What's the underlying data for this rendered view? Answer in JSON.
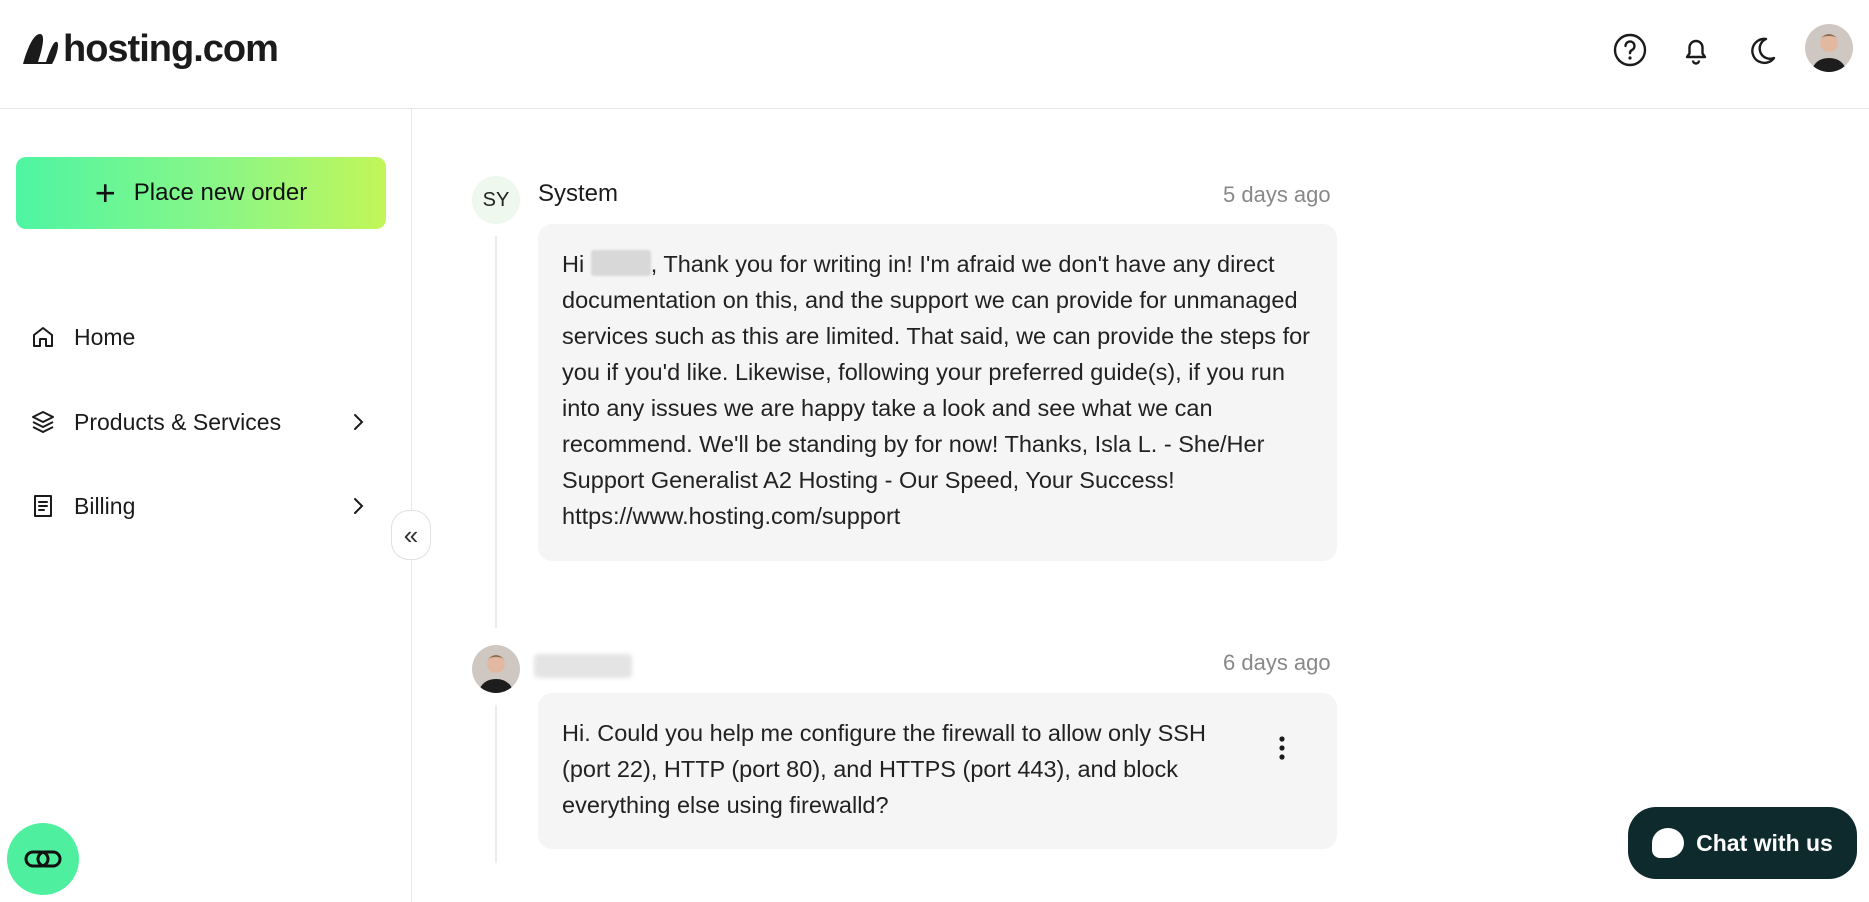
{
  "header": {
    "logo_text": "hosting.com",
    "icons": [
      "help-icon",
      "bell-icon",
      "moon-icon"
    ]
  },
  "sidebar": {
    "place_order_label": "Place new order",
    "items": [
      {
        "label": "Home",
        "icon": "home-icon"
      },
      {
        "label": "Products & Services",
        "icon": "layers-icon",
        "has_children": true
      },
      {
        "label": "Billing",
        "icon": "receipt-icon",
        "has_children": true
      }
    ],
    "collapse_icon": "«"
  },
  "messages": [
    {
      "avatar_initials": "SY",
      "author": "System",
      "time": "5 days ago",
      "text_prefix": "Hi ",
      "text_body": ", Thank you for writing in! I'm afraid we don't have any direct documentation on this, and the support we can provide for unmanaged services such as this are limited. That said, we can provide the steps for you if you'd like. Likewise, following your preferred guide(s), if you run into any issues we are happy take a look and see what we can recommend. We'll be standing by for now! Thanks, Isla L. - She/Her Support Generalist A2 Hosting - Our Speed, Your Success! https://www.hosting.com/support"
    },
    {
      "time": "6 days ago",
      "text": "Hi. Could you help me configure the firewall to allow only SSH (port 22), HTTP (port 80), and HTTPS (port 443), and block everything else using firewalld?"
    }
  ],
  "chat_widget": {
    "label": "Chat with us"
  },
  "colors": {
    "accent_green": "#4ef5a3",
    "accent_lime": "#c2f658",
    "chat_bg": "#0f2a2c"
  }
}
